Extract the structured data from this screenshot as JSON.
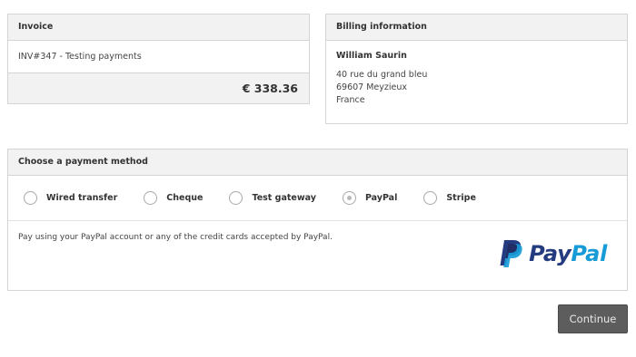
{
  "invoice": {
    "title": "Invoice",
    "reference": "INV#347 - Testing payments",
    "total": "€ 338.36"
  },
  "billing": {
    "title": "Billing information",
    "name": "William Saurin",
    "address_line1": "40 rue du grand bleu",
    "address_line2": "69607 Meyzieux",
    "country": "France"
  },
  "payment": {
    "title": "Choose a payment method",
    "methods": [
      {
        "label": "Wired transfer",
        "selected": false
      },
      {
        "label": "Cheque",
        "selected": false
      },
      {
        "label": "Test gateway",
        "selected": false
      },
      {
        "label": "PayPal",
        "selected": true
      },
      {
        "label": "Stripe",
        "selected": false
      }
    ],
    "description": "Pay using your PayPal account or any of the credit cards accepted by PayPal.",
    "logo": {
      "pay": "Pay",
      "pal": "Pal",
      "icon": "paypal-icon"
    }
  },
  "actions": {
    "continue_label": "Continue"
  },
  "colors": {
    "paypal_dark": "#253b80",
    "paypal_light": "#179bd7",
    "button_bg": "#5d5d5d",
    "panel_header_bg": "#f2f2f2"
  }
}
